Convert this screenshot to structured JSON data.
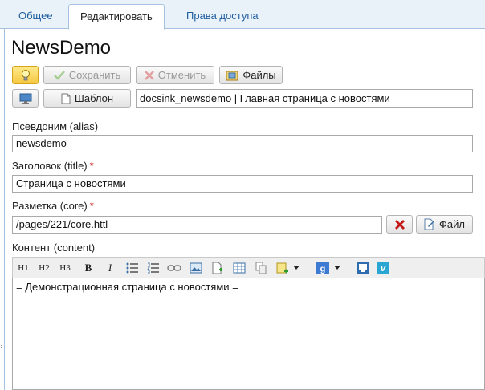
{
  "tabs": [
    {
      "label": "Общее"
    },
    {
      "label": "Редактировать",
      "active": true
    },
    {
      "label": "Права доступа"
    }
  ],
  "page_title": "NewsDemo",
  "toolbar": {
    "bulb_icon": "lightbulb-icon",
    "save_label": "Сохранить",
    "cancel_label": "Отменить",
    "files_label": "Файлы",
    "preview_icon": "monitor-icon",
    "template_label": "Шаблон"
  },
  "template_value": "docsink_newsdemo | Главная страница с новостями",
  "fields": {
    "alias_label": "Псевдоним (alias)",
    "alias_value": "newsdemo",
    "title_label": "Заголовок (title)",
    "title_value": "Страница с новостями",
    "core_label": "Разметка (core)",
    "core_value": "/pages/221/core.httl",
    "core_file_label": "Файл",
    "content_label": "Контент (content)"
  },
  "required_mark": "*",
  "editor_toolbar": [
    "H1",
    "H2",
    "H3",
    "B",
    "I"
  ],
  "editor_content": "= Демонстрационная страница с новостями =",
  "colors": {
    "accent": "#1f5d9e",
    "required": "#cc0000",
    "tab_bar": "#e9f1f9"
  }
}
